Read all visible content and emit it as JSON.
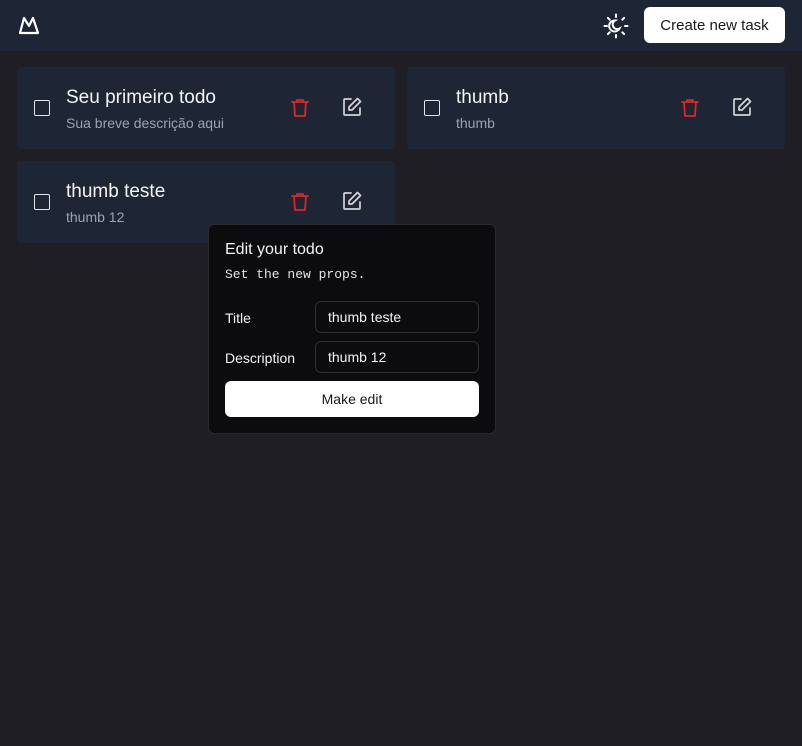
{
  "header": {
    "create_label": "Create new task"
  },
  "todos": [
    {
      "title": "Seu primeiro todo",
      "description": "Sua breve descrição aqui",
      "done": false
    },
    {
      "title": "thumb",
      "description": "thumb",
      "done": false
    },
    {
      "title": "thumb teste",
      "description": "thumb 12",
      "done": false
    }
  ],
  "edit_popover": {
    "title": "Edit your todo",
    "subtitle": "Set the new props.",
    "title_label": "Title",
    "title_value": "thumb teste",
    "description_label": "Description",
    "description_value": "thumb 12",
    "submit_label": "Make edit"
  },
  "icons": {
    "logo": "mountain-logo-icon",
    "theme": "sun-moon-icon",
    "delete": "trash-icon",
    "edit": "edit-icon"
  },
  "colors": {
    "page_bg": "#1e1e24",
    "topbar_bg": "#1e2636",
    "card_bg": "#1e2636",
    "delete_red": "#dc2626",
    "popover_bg": "#0c0c0e"
  }
}
